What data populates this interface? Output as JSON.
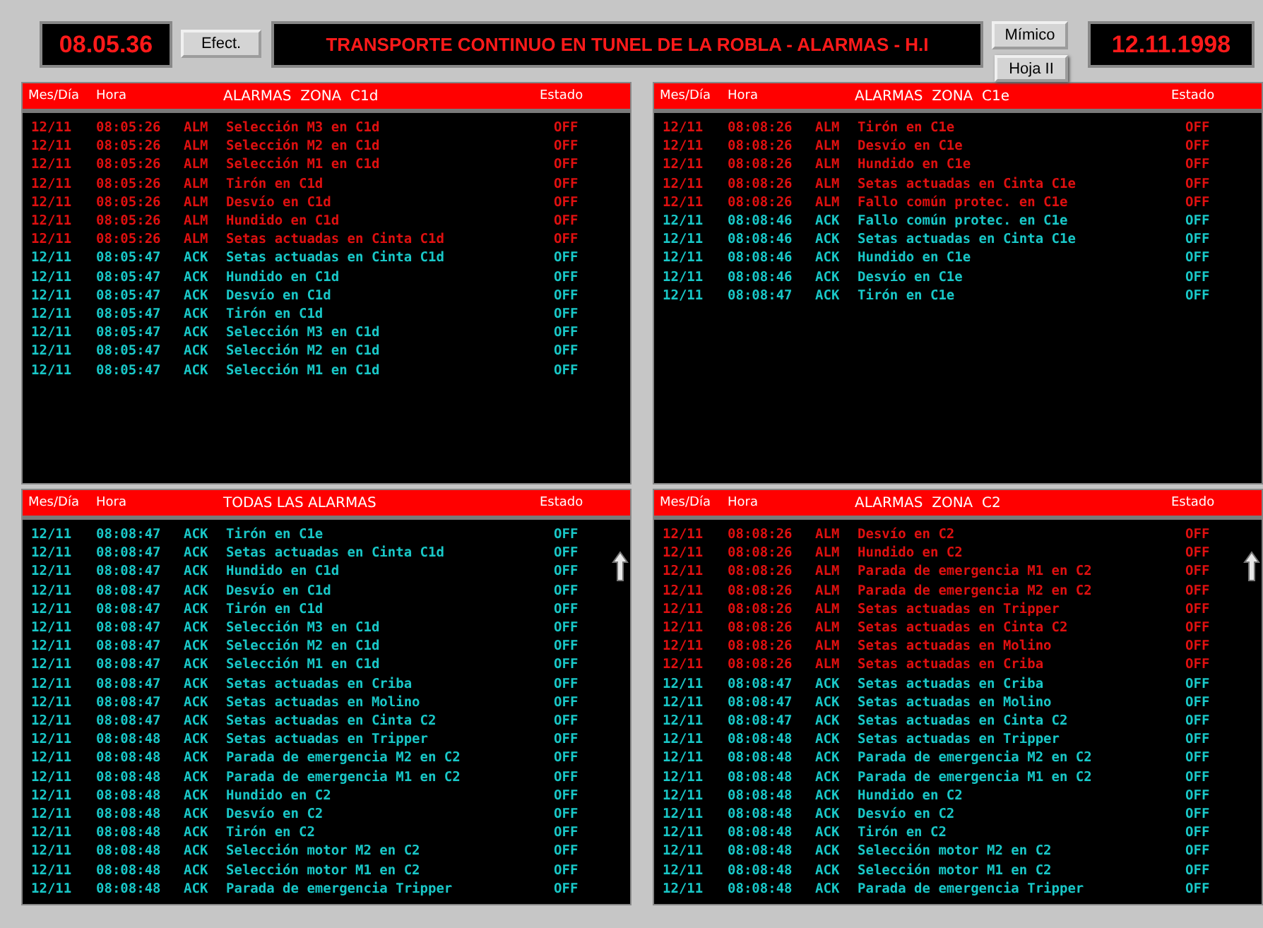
{
  "top_bar": {
    "clock": "08.05.36",
    "effect_button": "Efect.",
    "title": "TRANSPORTE CONTINUO EN TUNEL DE LA ROBLA - ALARMAS - H.I",
    "buttons": [
      "Mímico",
      "Hoja II"
    ],
    "date": "12.11.1998"
  },
  "panels": [
    {
      "title": "ALARMAS  ZONA  C1d",
      "columns": [
        "Mes/Día",
        "Hora",
        "Estado"
      ],
      "rows": [
        {
          "kind": "alarm",
          "date": "12/11",
          "time": "08:05:26",
          "type": "ALM",
          "text": "Selección M3 en C1d",
          "state": "OFF"
        },
        {
          "kind": "alarm",
          "date": "12/11",
          "time": "08:05:26",
          "type": "ALM",
          "text": "Selección M2 en C1d",
          "state": "OFF"
        },
        {
          "kind": "alarm",
          "date": "12/11",
          "time": "08:05:26",
          "type": "ALM",
          "text": "Selección M1 en C1d",
          "state": "OFF"
        },
        {
          "kind": "alarm",
          "date": "12/11",
          "time": "08:05:26",
          "type": "ALM",
          "text": "Tirón en C1d",
          "state": "OFF"
        },
        {
          "kind": "alarm",
          "date": "12/11",
          "time": "08:05:26",
          "type": "ALM",
          "text": "Desvío en C1d",
          "state": "OFF"
        },
        {
          "kind": "alarm",
          "date": "12/11",
          "time": "08:05:26",
          "type": "ALM",
          "text": "Hundido en C1d",
          "state": "OFF"
        },
        {
          "kind": "alarm",
          "date": "12/11",
          "time": "08:05:26",
          "type": "ALM",
          "text": "Setas actuadas en Cinta C1d",
          "state": "OFF"
        },
        {
          "kind": "ack",
          "date": "12/11",
          "time": "08:05:47",
          "type": "ACK",
          "text": "Setas actuadas en Cinta C1d",
          "state": "OFF"
        },
        {
          "kind": "ack",
          "date": "12/11",
          "time": "08:05:47",
          "type": "ACK",
          "text": "Hundido en C1d",
          "state": "OFF"
        },
        {
          "kind": "ack",
          "date": "12/11",
          "time": "08:05:47",
          "type": "ACK",
          "text": "Desvío en C1d",
          "state": "OFF"
        },
        {
          "kind": "ack",
          "date": "12/11",
          "time": "08:05:47",
          "type": "ACK",
          "text": "Tirón en C1d",
          "state": "OFF"
        },
        {
          "kind": "ack",
          "date": "12/11",
          "time": "08:05:47",
          "type": "ACK",
          "text": "Selección M3 en C1d",
          "state": "OFF"
        },
        {
          "kind": "ack",
          "date": "12/11",
          "time": "08:05:47",
          "type": "ACK",
          "text": "Selección M2 en C1d",
          "state": "OFF"
        },
        {
          "kind": "ack",
          "date": "12/11",
          "time": "08:05:47",
          "type": "ACK",
          "text": "Selección M1 en C1d",
          "state": "OFF"
        }
      ]
    },
    {
      "title": "ALARMAS  ZONA  C1e",
      "columns": [
        "Mes/Día",
        "Hora",
        "Estado"
      ],
      "rows": [
        {
          "kind": "alarm",
          "date": "12/11",
          "time": "08:08:26",
          "type": "ALM",
          "text": "Tirón en C1e",
          "state": "OFF"
        },
        {
          "kind": "alarm",
          "date": "12/11",
          "time": "08:08:26",
          "type": "ALM",
          "text": "Desvío en C1e",
          "state": "OFF"
        },
        {
          "kind": "alarm",
          "date": "12/11",
          "time": "08:08:26",
          "type": "ALM",
          "text": "Hundido en C1e",
          "state": "OFF"
        },
        {
          "kind": "alarm",
          "date": "12/11",
          "time": "08:08:26",
          "type": "ALM",
          "text": "Setas actuadas en Cinta C1e",
          "state": "OFF"
        },
        {
          "kind": "alarm",
          "date": "12/11",
          "time": "08:08:26",
          "type": "ALM",
          "text": "Fallo común protec. en C1e",
          "state": "OFF"
        },
        {
          "kind": "ack",
          "date": "12/11",
          "time": "08:08:46",
          "type": "ACK",
          "text": "Fallo común protec. en C1e",
          "state": "OFF"
        },
        {
          "kind": "ack",
          "date": "12/11",
          "time": "08:08:46",
          "type": "ACK",
          "text": "Setas actuadas en Cinta C1e",
          "state": "OFF"
        },
        {
          "kind": "ack",
          "date": "12/11",
          "time": "08:08:46",
          "type": "ACK",
          "text": "Hundido en C1e",
          "state": "OFF"
        },
        {
          "kind": "ack",
          "date": "12/11",
          "time": "08:08:46",
          "type": "ACK",
          "text": "Desvío en C1e",
          "state": "OFF"
        },
        {
          "kind": "ack",
          "date": "12/11",
          "time": "08:08:47",
          "type": "ACK",
          "text": "Tirón en C1e",
          "state": "OFF"
        }
      ]
    },
    {
      "title": "TODAS LAS ALARMAS",
      "columns": [
        "Mes/Día",
        "Hora",
        "Estado"
      ],
      "scroll_arrow": true,
      "rows": [
        {
          "kind": "ack",
          "date": "12/11",
          "time": "08:08:47",
          "type": "ACK",
          "text": "Tirón en C1e",
          "state": "OFF"
        },
        {
          "kind": "ack",
          "date": "12/11",
          "time": "08:08:47",
          "type": "ACK",
          "text": "Setas actuadas en Cinta C1d",
          "state": "OFF"
        },
        {
          "kind": "ack",
          "date": "12/11",
          "time": "08:08:47",
          "type": "ACK",
          "text": "Hundido en C1d",
          "state": "OFF"
        },
        {
          "kind": "ack",
          "date": "12/11",
          "time": "08:08:47",
          "type": "ACK",
          "text": "Desvío en C1d",
          "state": "OFF"
        },
        {
          "kind": "ack",
          "date": "12/11",
          "time": "08:08:47",
          "type": "ACK",
          "text": "Tirón en C1d",
          "state": "OFF"
        },
        {
          "kind": "ack",
          "date": "12/11",
          "time": "08:08:47",
          "type": "ACK",
          "text": "Selección M3 en C1d",
          "state": "OFF"
        },
        {
          "kind": "ack",
          "date": "12/11",
          "time": "08:08:47",
          "type": "ACK",
          "text": "Selección M2 en C1d",
          "state": "OFF"
        },
        {
          "kind": "ack",
          "date": "12/11",
          "time": "08:08:47",
          "type": "ACK",
          "text": "Selección M1 en C1d",
          "state": "OFF"
        },
        {
          "kind": "ack",
          "date": "12/11",
          "time": "08:08:47",
          "type": "ACK",
          "text": "Setas actuadas en Criba",
          "state": "OFF"
        },
        {
          "kind": "ack",
          "date": "12/11",
          "time": "08:08:47",
          "type": "ACK",
          "text": "Setas actuadas en Molino",
          "state": "OFF"
        },
        {
          "kind": "ack",
          "date": "12/11",
          "time": "08:08:47",
          "type": "ACK",
          "text": "Setas actuadas en Cinta C2",
          "state": "OFF"
        },
        {
          "kind": "ack",
          "date": "12/11",
          "time": "08:08:48",
          "type": "ACK",
          "text": "Setas actuadas en Tripper",
          "state": "OFF"
        },
        {
          "kind": "ack",
          "date": "12/11",
          "time": "08:08:48",
          "type": "ACK",
          "text": "Parada de emergencia M2 en C2",
          "state": "OFF"
        },
        {
          "kind": "ack",
          "date": "12/11",
          "time": "08:08:48",
          "type": "ACK",
          "text": "Parada de emergencia M1 en C2",
          "state": "OFF"
        },
        {
          "kind": "ack",
          "date": "12/11",
          "time": "08:08:48",
          "type": "ACK",
          "text": "Hundido en C2",
          "state": "OFF"
        },
        {
          "kind": "ack",
          "date": "12/11",
          "time": "08:08:48",
          "type": "ACK",
          "text": "Desvío en C2",
          "state": "OFF"
        },
        {
          "kind": "ack",
          "date": "12/11",
          "time": "08:08:48",
          "type": "ACK",
          "text": "Tirón en C2",
          "state": "OFF"
        },
        {
          "kind": "ack",
          "date": "12/11",
          "time": "08:08:48",
          "type": "ACK",
          "text": "Selección motor M2 en C2",
          "state": "OFF"
        },
        {
          "kind": "ack",
          "date": "12/11",
          "time": "08:08:48",
          "type": "ACK",
          "text": "Selección motor M1 en C2",
          "state": "OFF"
        },
        {
          "kind": "ack",
          "date": "12/11",
          "time": "08:08:48",
          "type": "ACK",
          "text": "Parada de emergencia Tripper",
          "state": "OFF"
        }
      ]
    },
    {
      "title": "ALARMAS  ZONA  C2",
      "columns": [
        "Mes/Día",
        "Hora",
        "Estado"
      ],
      "scroll_arrow": true,
      "rows": [
        {
          "kind": "alarm",
          "date": "12/11",
          "time": "08:08:26",
          "type": "ALM",
          "text": "Desvío en C2",
          "state": "OFF"
        },
        {
          "kind": "alarm",
          "date": "12/11",
          "time": "08:08:26",
          "type": "ALM",
          "text": "Hundido en C2",
          "state": "OFF"
        },
        {
          "kind": "alarm",
          "date": "12/11",
          "time": "08:08:26",
          "type": "ALM",
          "text": "Parada de emergencia M1 en C2",
          "state": "OFF"
        },
        {
          "kind": "alarm",
          "date": "12/11",
          "time": "08:08:26",
          "type": "ALM",
          "text": "Parada de emergencia M2 en C2",
          "state": "OFF"
        },
        {
          "kind": "alarm",
          "date": "12/11",
          "time": "08:08:26",
          "type": "ALM",
          "text": "Setas actuadas en Tripper",
          "state": "OFF"
        },
        {
          "kind": "alarm",
          "date": "12/11",
          "time": "08:08:26",
          "type": "ALM",
          "text": "Setas actuadas en Cinta C2",
          "state": "OFF"
        },
        {
          "kind": "alarm",
          "date": "12/11",
          "time": "08:08:26",
          "type": "ALM",
          "text": "Setas actuadas en Molino",
          "state": "OFF"
        },
        {
          "kind": "alarm",
          "date": "12/11",
          "time": "08:08:26",
          "type": "ALM",
          "text": "Setas actuadas en Criba",
          "state": "OFF"
        },
        {
          "kind": "ack",
          "date": "12/11",
          "time": "08:08:47",
          "type": "ACK",
          "text": "Setas actuadas en Criba",
          "state": "OFF"
        },
        {
          "kind": "ack",
          "date": "12/11",
          "time": "08:08:47",
          "type": "ACK",
          "text": "Setas actuadas en Molino",
          "state": "OFF"
        },
        {
          "kind": "ack",
          "date": "12/11",
          "time": "08:08:47",
          "type": "ACK",
          "text": "Setas actuadas en Cinta C2",
          "state": "OFF"
        },
        {
          "kind": "ack",
          "date": "12/11",
          "time": "08:08:48",
          "type": "ACK",
          "text": "Setas actuadas en Tripper",
          "state": "OFF"
        },
        {
          "kind": "ack",
          "date": "12/11",
          "time": "08:08:48",
          "type": "ACK",
          "text": "Parada de emergencia M2 en C2",
          "state": "OFF"
        },
        {
          "kind": "ack",
          "date": "12/11",
          "time": "08:08:48",
          "type": "ACK",
          "text": "Parada de emergencia M1 en C2",
          "state": "OFF"
        },
        {
          "kind": "ack",
          "date": "12/11",
          "time": "08:08:48",
          "type": "ACK",
          "text": "Hundido en C2",
          "state": "OFF"
        },
        {
          "kind": "ack",
          "date": "12/11",
          "time": "08:08:48",
          "type": "ACK",
          "text": "Desvío en C2",
          "state": "OFF"
        },
        {
          "kind": "ack",
          "date": "12/11",
          "time": "08:08:48",
          "type": "ACK",
          "text": "Tirón en C2",
          "state": "OFF"
        },
        {
          "kind": "ack",
          "date": "12/11",
          "time": "08:08:48",
          "type": "ACK",
          "text": "Selección motor M2 en C2",
          "state": "OFF"
        },
        {
          "kind": "ack",
          "date": "12/11",
          "time": "08:08:48",
          "type": "ACK",
          "text": "Selección motor M1 en C2",
          "state": "OFF"
        },
        {
          "kind": "ack",
          "date": "12/11",
          "time": "08:08:48",
          "type": "ACK",
          "text": "Parada de emergencia Tripper",
          "state": "OFF"
        }
      ]
    }
  ]
}
